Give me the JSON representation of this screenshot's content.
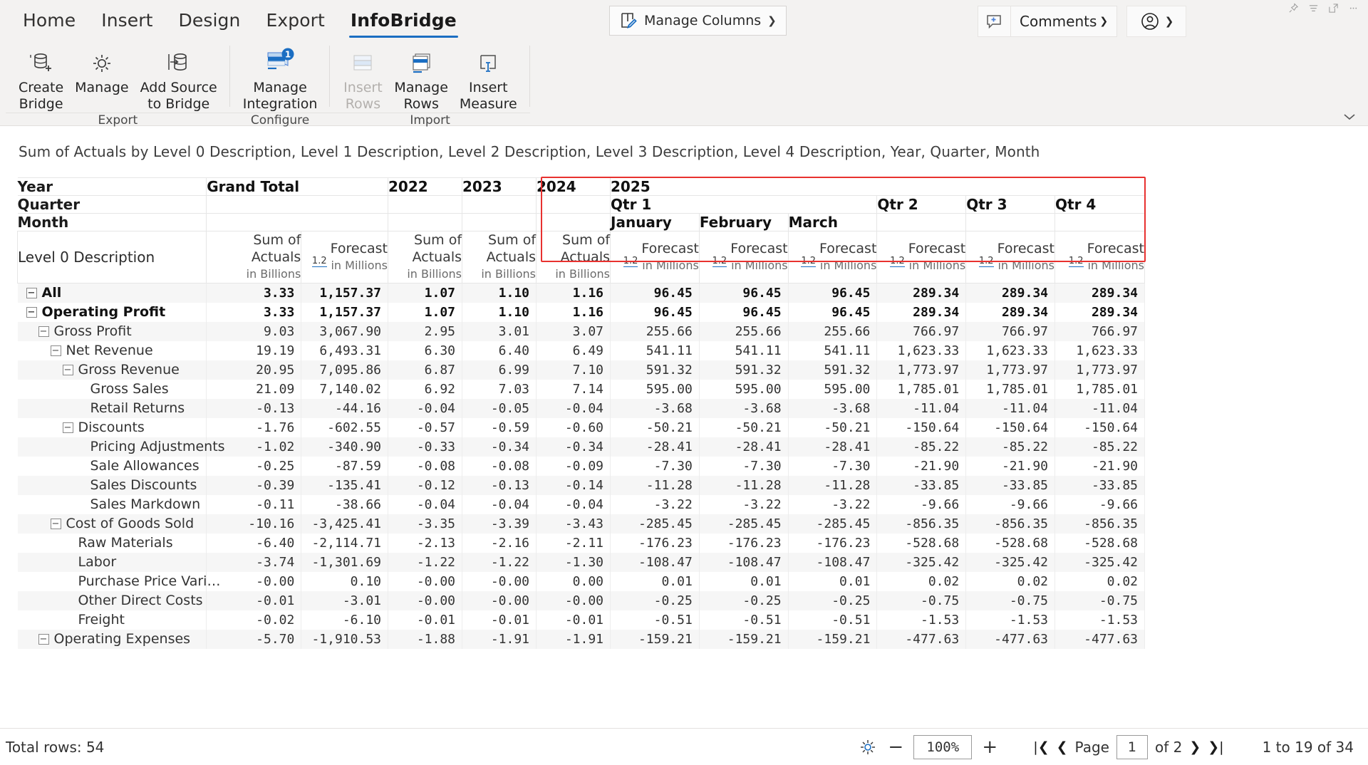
{
  "ribbon": {
    "tabs": [
      {
        "label": "Home",
        "active": false
      },
      {
        "label": "Insert",
        "active": false
      },
      {
        "label": "Design",
        "active": false
      },
      {
        "label": "Export",
        "active": false
      },
      {
        "label": "InfoBridge",
        "active": true
      }
    ],
    "manage_columns_label": "Manage Columns",
    "comments_label": "Comments",
    "groups": [
      {
        "label": "Export",
        "commands": [
          {
            "id": "create-bridge",
            "label": "Create\nBridge",
            "icon": "add-database-icon",
            "disabled": false,
            "badge": null
          },
          {
            "id": "manage",
            "label": "Manage",
            "icon": "gear-icon",
            "disabled": false,
            "badge": null
          },
          {
            "id": "add-source-to-bridge",
            "label": "Add Source\nto Bridge",
            "icon": "database-arrow-icon",
            "disabled": false,
            "badge": null
          }
        ]
      },
      {
        "label": "Configure",
        "commands": [
          {
            "id": "manage-integration",
            "label": "Manage\nIntegration",
            "icon": "integration-icon",
            "disabled": false,
            "badge": "1"
          }
        ]
      },
      {
        "label": "Import",
        "commands": [
          {
            "id": "insert-rows",
            "label": "Insert\nRows",
            "icon": "insert-rows-icon",
            "disabled": true,
            "badge": null
          },
          {
            "id": "manage-rows",
            "label": "Manage\nRows",
            "icon": "manage-rows-icon",
            "disabled": false,
            "badge": null
          },
          {
            "id": "insert-measure",
            "label": "Insert\nMeasure",
            "icon": "insert-measure-icon",
            "disabled": false,
            "badge": null
          }
        ]
      }
    ],
    "window_tools": [
      "pin-icon",
      "ribbon-display-icon",
      "expand-icon",
      "more-options-icon"
    ]
  },
  "pivot": {
    "title": "Sum of Actuals by Level 0 Description, Level 1 Description, Level 2 Description, Level 3 Description, Level 4 Description, Year, Quarter, Month",
    "row_headers": [
      "Year",
      "Quarter",
      "Month"
    ],
    "corner_label": "Level 0 Description",
    "numfmt_label": "1.2",
    "selection_color": "#e8312f",
    "year_headers": [
      {
        "label": "Grand Total",
        "span": 2
      },
      {
        "label": "2022",
        "span": 1
      },
      {
        "label": "2023",
        "span": 1
      },
      {
        "label": "2024",
        "span": 1
      },
      {
        "label": "2025",
        "span": 6,
        "selected": true
      }
    ],
    "quarter_headers": [
      {
        "label": "",
        "span": 5
      },
      {
        "label": "Qtr 1",
        "span": 3
      },
      {
        "label": "Qtr 2",
        "span": 1
      },
      {
        "label": "Qtr 3",
        "span": 1
      },
      {
        "label": "Qtr 4",
        "span": 1
      }
    ],
    "month_headers": [
      {
        "label": "",
        "span": 5
      },
      {
        "label": "January",
        "span": 1
      },
      {
        "label": "February",
        "span": 1
      },
      {
        "label": "March",
        "span": 1
      },
      {
        "label": "",
        "span": 1
      },
      {
        "label": "",
        "span": 1
      },
      {
        "label": "",
        "span": 1
      }
    ],
    "measure_headers": [
      {
        "name": "Sum of Actuals",
        "unit": "in Billions",
        "numfmt": false
      },
      {
        "name": "Forecast",
        "unit": "in Millions",
        "numfmt": true
      },
      {
        "name": "Sum of Actuals",
        "unit": "in Billions",
        "numfmt": false
      },
      {
        "name": "Sum of Actuals",
        "unit": "in Billions",
        "numfmt": false
      },
      {
        "name": "Sum of Actuals",
        "unit": "in Billions",
        "numfmt": false
      },
      {
        "name": "Forecast",
        "unit": "in Millions",
        "numfmt": true
      },
      {
        "name": "Forecast",
        "unit": "in Millions",
        "numfmt": true
      },
      {
        "name": "Forecast",
        "unit": "in Millions",
        "numfmt": true
      },
      {
        "name": "Forecast",
        "unit": "in Millions",
        "numfmt": true
      },
      {
        "name": "Forecast",
        "unit": "in Millions",
        "numfmt": true
      },
      {
        "name": "Forecast",
        "unit": "in Millions",
        "numfmt": true
      }
    ],
    "rows": [
      {
        "label": "All",
        "indent": 0,
        "expander": "minus",
        "bold": true,
        "values": [
          "3.33",
          "1,157.37",
          "1.07",
          "1.10",
          "1.16",
          "96.45",
          "96.45",
          "96.45",
          "289.34",
          "289.34",
          "289.34"
        ]
      },
      {
        "label": "Operating Profit",
        "indent": 0,
        "expander": "minus",
        "bold": true,
        "values": [
          "3.33",
          "1,157.37",
          "1.07",
          "1.10",
          "1.16",
          "96.45",
          "96.45",
          "96.45",
          "289.34",
          "289.34",
          "289.34"
        ]
      },
      {
        "label": "Gross Profit",
        "indent": 1,
        "expander": "minus",
        "bold": false,
        "values": [
          "9.03",
          "3,067.90",
          "2.95",
          "3.01",
          "3.07",
          "255.66",
          "255.66",
          "255.66",
          "766.97",
          "766.97",
          "766.97"
        ]
      },
      {
        "label": "Net Revenue",
        "indent": 2,
        "expander": "minus",
        "bold": false,
        "values": [
          "19.19",
          "6,493.31",
          "6.30",
          "6.40",
          "6.49",
          "541.11",
          "541.11",
          "541.11",
          "1,623.33",
          "1,623.33",
          "1,623.33"
        ]
      },
      {
        "label": "Gross Revenue",
        "indent": 3,
        "expander": "minus",
        "bold": false,
        "values": [
          "20.95",
          "7,095.86",
          "6.87",
          "6.99",
          "7.10",
          "591.32",
          "591.32",
          "591.32",
          "1,773.97",
          "1,773.97",
          "1,773.97"
        ]
      },
      {
        "label": "Gross Sales",
        "indent": 4,
        "expander": "none",
        "bold": false,
        "values": [
          "21.09",
          "7,140.02",
          "6.92",
          "7.03",
          "7.14",
          "595.00",
          "595.00",
          "595.00",
          "1,785.01",
          "1,785.01",
          "1,785.01"
        ]
      },
      {
        "label": "Retail Returns",
        "indent": 4,
        "expander": "none",
        "bold": false,
        "values": [
          "-0.13",
          "-44.16",
          "-0.04",
          "-0.05",
          "-0.04",
          "-3.68",
          "-3.68",
          "-3.68",
          "-11.04",
          "-11.04",
          "-11.04"
        ]
      },
      {
        "label": "Discounts",
        "indent": 3,
        "expander": "minus",
        "bold": false,
        "values": [
          "-1.76",
          "-602.55",
          "-0.57",
          "-0.59",
          "-0.60",
          "-50.21",
          "-50.21",
          "-50.21",
          "-150.64",
          "-150.64",
          "-150.64"
        ]
      },
      {
        "label": "Pricing Adjustments",
        "indent": 4,
        "expander": "none",
        "bold": false,
        "values": [
          "-1.02",
          "-340.90",
          "-0.33",
          "-0.34",
          "-0.34",
          "-28.41",
          "-28.41",
          "-28.41",
          "-85.22",
          "-85.22",
          "-85.22"
        ]
      },
      {
        "label": "Sale Allowances",
        "indent": 4,
        "expander": "none",
        "bold": false,
        "values": [
          "-0.25",
          "-87.59",
          "-0.08",
          "-0.08",
          "-0.09",
          "-7.30",
          "-7.30",
          "-7.30",
          "-21.90",
          "-21.90",
          "-21.90"
        ]
      },
      {
        "label": "Sales Discounts",
        "indent": 4,
        "expander": "none",
        "bold": false,
        "values": [
          "-0.39",
          "-135.41",
          "-0.12",
          "-0.13",
          "-0.14",
          "-11.28",
          "-11.28",
          "-11.28",
          "-33.85",
          "-33.85",
          "-33.85"
        ]
      },
      {
        "label": "Sales Markdown",
        "indent": 4,
        "expander": "none",
        "bold": false,
        "values": [
          "-0.11",
          "-38.66",
          "-0.04",
          "-0.04",
          "-0.04",
          "-3.22",
          "-3.22",
          "-3.22",
          "-9.66",
          "-9.66",
          "-9.66"
        ]
      },
      {
        "label": "Cost of Goods Sold",
        "indent": 2,
        "expander": "minus",
        "bold": false,
        "values": [
          "-10.16",
          "-3,425.41",
          "-3.35",
          "-3.39",
          "-3.43",
          "-285.45",
          "-285.45",
          "-285.45",
          "-856.35",
          "-856.35",
          "-856.35"
        ]
      },
      {
        "label": "Raw Materials",
        "indent": 3,
        "expander": "none",
        "bold": false,
        "values": [
          "-6.40",
          "-2,114.71",
          "-2.13",
          "-2.16",
          "-2.11",
          "-176.23",
          "-176.23",
          "-176.23",
          "-528.68",
          "-528.68",
          "-528.68"
        ]
      },
      {
        "label": "Labor",
        "indent": 3,
        "expander": "none",
        "bold": false,
        "values": [
          "-3.74",
          "-1,301.69",
          "-1.22",
          "-1.22",
          "-1.30",
          "-108.47",
          "-108.47",
          "-108.47",
          "-325.42",
          "-325.42",
          "-325.42"
        ]
      },
      {
        "label": "Purchase Price Vari…",
        "indent": 3,
        "expander": "none",
        "bold": false,
        "values": [
          "-0.00",
          "0.10",
          "-0.00",
          "-0.00",
          "0.00",
          "0.01",
          "0.01",
          "0.01",
          "0.02",
          "0.02",
          "0.02"
        ]
      },
      {
        "label": "Other Direct Costs",
        "indent": 3,
        "expander": "none",
        "bold": false,
        "values": [
          "-0.01",
          "-3.01",
          "-0.00",
          "-0.00",
          "-0.00",
          "-0.25",
          "-0.25",
          "-0.25",
          "-0.75",
          "-0.75",
          "-0.75"
        ]
      },
      {
        "label": "Freight",
        "indent": 3,
        "expander": "none",
        "bold": false,
        "values": [
          "-0.02",
          "-6.10",
          "-0.01",
          "-0.01",
          "-0.01",
          "-0.51",
          "-0.51",
          "-0.51",
          "-1.53",
          "-1.53",
          "-1.53"
        ]
      },
      {
        "label": "Operating Expenses",
        "indent": 1,
        "expander": "minus",
        "bold": false,
        "values": [
          "-5.70",
          "-1,910.53",
          "-1.88",
          "-1.91",
          "-1.91",
          "-159.21",
          "-159.21",
          "-159.21",
          "-477.63",
          "-477.63",
          "-477.63"
        ]
      }
    ]
  },
  "statusbar": {
    "total_rows": "Total rows: 54",
    "zoom": "100%",
    "zoom_out": "−",
    "zoom_in": "+",
    "page_label": "Page",
    "page_value": "1",
    "page_of": "of 2",
    "range": "1 to 19 of 34"
  }
}
